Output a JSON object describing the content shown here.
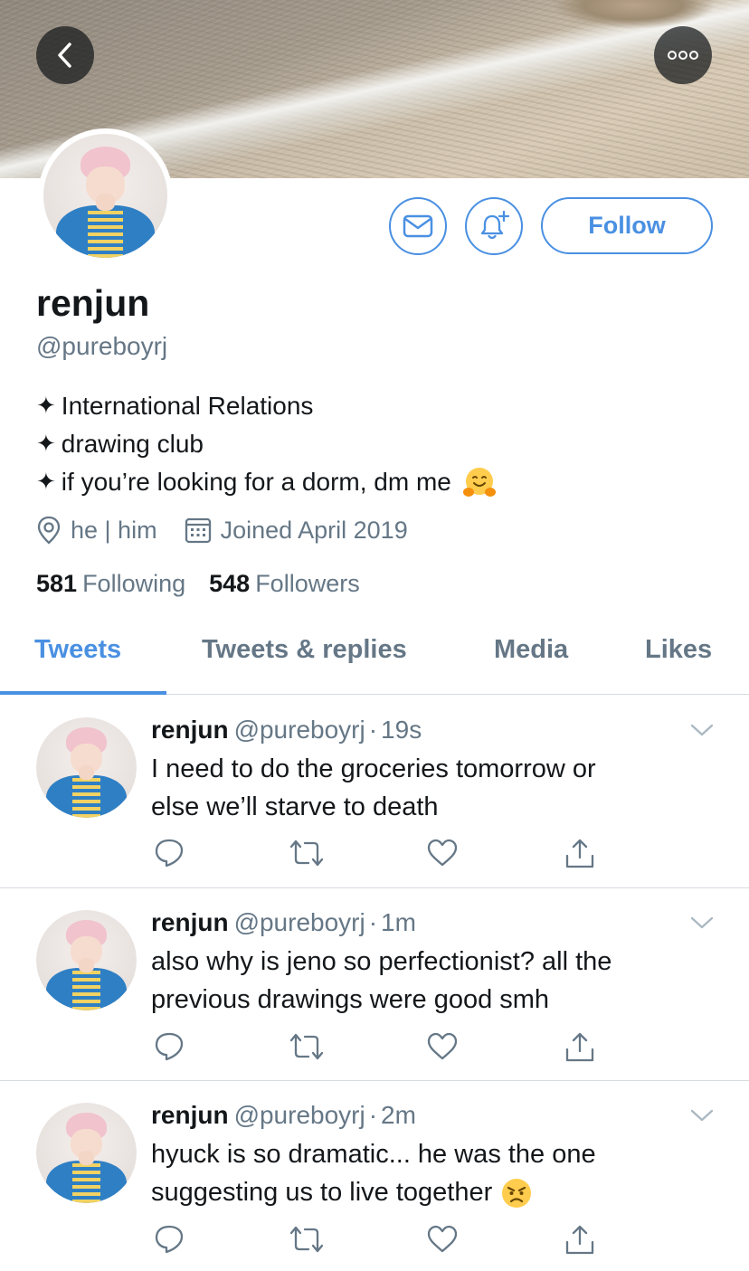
{
  "profile": {
    "display_name": "renjun",
    "handle": "@pureboyrj",
    "bio": [
      "International Relations",
      "drawing club",
      "if you’re looking for a dorm, dm me"
    ],
    "bio_bullet": "✦",
    "location": "he | him",
    "joined": "Joined April 2019",
    "following_count": "581",
    "following_label": "Following",
    "followers_count": "548",
    "followers_label": "Followers"
  },
  "actions": {
    "follow_label": "Follow"
  },
  "tabs": [
    {
      "label": "Tweets",
      "active": true
    },
    {
      "label": "Tweets & replies",
      "active": false
    },
    {
      "label": "Media",
      "active": false
    },
    {
      "label": "Likes",
      "active": false
    }
  ],
  "tweets": [
    {
      "name": "renjun",
      "handle": "@pureboyrj",
      "dot": "·",
      "time": "19s",
      "line1": "I need to do the groceries tomorrow or",
      "line2": "else we’ll starve to death"
    },
    {
      "name": "renjun",
      "handle": "@pureboyrj",
      "dot": "·",
      "time": "1m",
      "line1": "also why is jeno so perfectionist? all the",
      "line2": "previous drawings were good smh"
    },
    {
      "name": "renjun",
      "handle": "@pureboyrj",
      "dot": "·",
      "time": "2m",
      "line1": "hyuck is so dramatic... he was the one",
      "line2": "suggesting us to live together"
    }
  ],
  "colors": {
    "accent": "#4a90e2",
    "secondary_text": "#657786",
    "primary_text": "#14171a",
    "divider": "#d6dbe0"
  },
  "icons": [
    "back-arrow-icon",
    "more-icon",
    "mail-icon",
    "bell-plus-icon",
    "location-pin-icon",
    "calendar-icon",
    "reply-icon",
    "retweet-icon",
    "like-icon",
    "share-icon",
    "chevron-down-icon",
    "hugging-face-emoji",
    "angry-face-emoji"
  ]
}
